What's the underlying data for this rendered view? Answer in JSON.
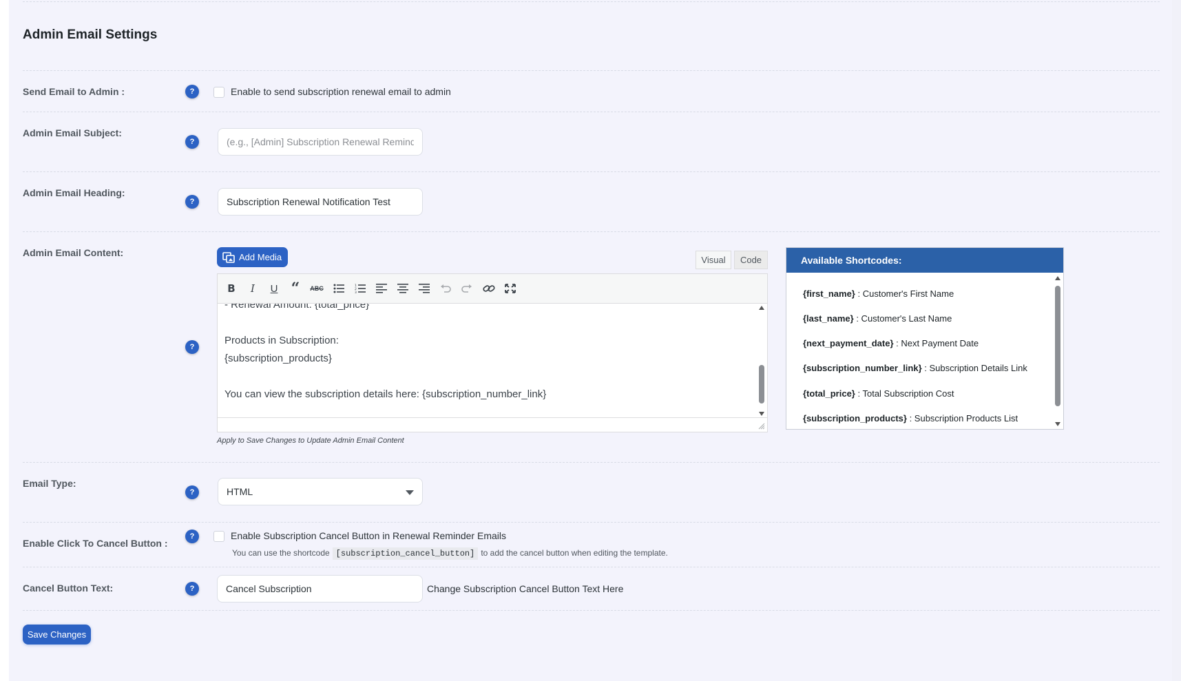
{
  "section": {
    "title": "Admin Email Settings"
  },
  "send_email": {
    "label": "Send Email to Admin :",
    "checkbox_label": "Enable to send subscription renewal email to admin",
    "checked": false
  },
  "subject": {
    "label": "Admin Email Subject:",
    "placeholder": "(e.g., [Admin] Subscription Renewal Reminder)",
    "value": ""
  },
  "heading": {
    "label": "Admin Email Heading:",
    "value": "Subscription Renewal Notification Test"
  },
  "content": {
    "label": "Admin Email Content:",
    "add_media_label": "Add Media",
    "tab_visual": "Visual",
    "tab_code": "Code",
    "toolbar_icons": [
      "bold-icon",
      "italic-icon",
      "underline-icon",
      "blockquote-icon",
      "strikethrough-icon",
      "bulleted-list-icon",
      "numbered-list-icon",
      "align-left-icon",
      "align-center-icon",
      "align-right-icon",
      "undo-icon",
      "redo-icon",
      "link-icon",
      "fullscreen-icon"
    ],
    "lines": [
      "- Renewal Amount: {total_price}",
      "",
      "Products in Subscription:",
      "{subscription_products}",
      "",
      "You can view the subscription details here: {subscription_number_link}"
    ],
    "note": "Apply to Save Changes to Update Admin Email Content"
  },
  "shortcodes": {
    "title": "Available Shortcodes:",
    "items": [
      {
        "code": "{first_name}",
        "desc": " : Customer's First Name"
      },
      {
        "code": "{last_name}",
        "desc": " : Customer's Last Name"
      },
      {
        "code": "{next_payment_date}",
        "desc": " : Next Payment Date"
      },
      {
        "code": "{subscription_number_link}",
        "desc": " : Subscription Details Link"
      },
      {
        "code": "{total_price}",
        "desc": " : Total Subscription Cost"
      },
      {
        "code": "{subscription_products}",
        "desc": " : Subscription Products List"
      }
    ]
  },
  "email_type": {
    "label": "Email Type:",
    "selected": "HTML"
  },
  "cancel_button": {
    "label": "Enable Click To Cancel Button :",
    "checkbox_label": "Enable Subscription Cancel Button in Renewal Reminder Emails",
    "checked": false,
    "hint_before": "You can use the shortcode",
    "hint_code": "[subscription_cancel_button]",
    "hint_after": "to add the cancel button when editing the template."
  },
  "cancel_text": {
    "label": "Cancel Button Text:",
    "value": "Cancel Subscription",
    "hint": "Change Subscription Cancel Button Text Here"
  },
  "save_label": "Save Changes",
  "help_glyph": "?",
  "colors": {
    "accent": "#2c62c4",
    "shortcode_header": "#2b61a8",
    "background": "#f3f3fc"
  }
}
